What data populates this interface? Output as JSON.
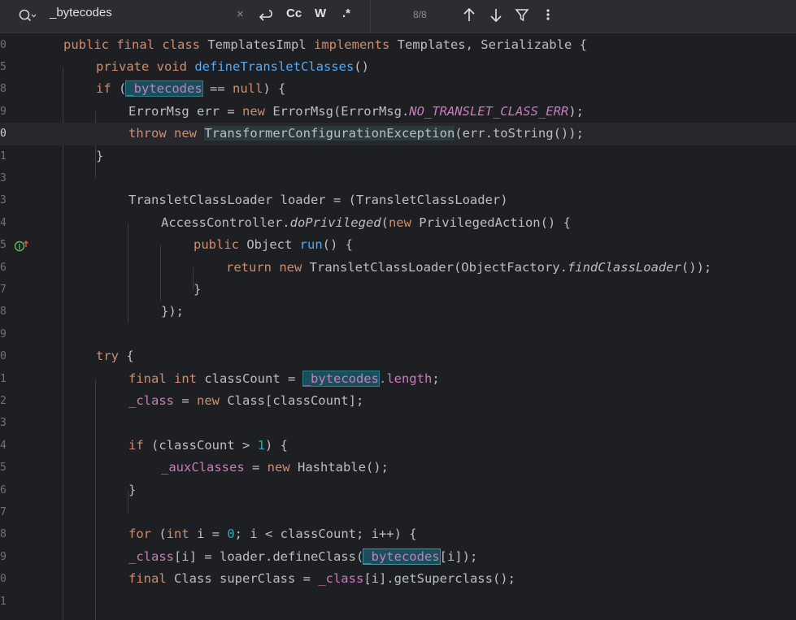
{
  "search": {
    "query": "_bytecodes",
    "clear_glyph": "×",
    "wrap_icon": "wrap-icon",
    "match_case": "Cc",
    "whole_word": "W",
    "regex": ".*",
    "match_count": "8/8",
    "prev_icon": "arrow-up-icon",
    "next_icon": "arrow-down-icon",
    "filter_icon": "filter-icon",
    "more_icon": "more-icon"
  },
  "lines": [
    {
      "num": "0",
      "indent": 0,
      "tokens": [
        [
          "kw",
          "public "
        ],
        [
          "kw",
          "final "
        ],
        [
          "kw",
          "class "
        ],
        [
          "",
          "TemplatesImpl "
        ],
        [
          "kw",
          "implements "
        ],
        [
          "",
          "Templates, Serializable {"
        ]
      ]
    },
    {
      "num": "5",
      "indent": 1,
      "tokens": [
        [
          "kw",
          "private "
        ],
        [
          "kw",
          "void "
        ],
        [
          "fn",
          "defineTransletClasses"
        ],
        [
          "",
          "()"
        ]
      ]
    },
    {
      "num": "8",
      "indent": 1,
      "tokens": [
        [
          "kw",
          "if "
        ],
        [
          "",
          "("
        ],
        [
          "fld hl",
          "_bytecodes"
        ],
        [
          "",
          " == "
        ],
        [
          "kw",
          "null"
        ],
        [
          "",
          ") {"
        ]
      ]
    },
    {
      "num": "9",
      "indent": 2,
      "tokens": [
        [
          "",
          "ErrorMsg err = "
        ],
        [
          "kw",
          "new "
        ],
        [
          "",
          "ErrorMsg(ErrorMsg."
        ],
        [
          "fld ital",
          "NO_TRANSLET_CLASS_ERR"
        ],
        [
          "",
          ");"
        ]
      ]
    },
    {
      "num": "0",
      "indent": 2,
      "tokens": [
        [
          "kw",
          "throw "
        ],
        [
          "kw",
          "new "
        ],
        [
          "refbox",
          "TransformerConfigurationException"
        ],
        [
          "",
          "(err.toString());"
        ]
      ]
    },
    {
      "num": "1",
      "indent": 1,
      "tokens": [
        [
          "",
          "}"
        ]
      ]
    },
    {
      "num": "3",
      "indent": 0,
      "tokens": []
    },
    {
      "num": "3",
      "indent": 2,
      "tokens": [
        [
          "",
          "TransletClassLoader loader = (TransletClassLoader)"
        ]
      ]
    },
    {
      "num": "4",
      "indent": 3,
      "tokens": [
        [
          "",
          "AccessController."
        ],
        [
          "ital",
          "doPrivileged"
        ],
        [
          "",
          "("
        ],
        [
          "kw",
          "new "
        ],
        [
          "",
          "PrivilegedAction() {"
        ]
      ]
    },
    {
      "num": "5",
      "indent": 4,
      "tokens": [
        [
          "kw",
          "public "
        ],
        [
          "",
          "Object "
        ],
        [
          "fn",
          "run"
        ],
        [
          "",
          "() {"
        ]
      ]
    },
    {
      "num": "6",
      "indent": 5,
      "tokens": [
        [
          "kw",
          "return "
        ],
        [
          "kw",
          "new "
        ],
        [
          "",
          "TransletClassLoader(ObjectFactory."
        ],
        [
          "ital",
          "findClassLoader"
        ],
        [
          "",
          "());"
        ]
      ]
    },
    {
      "num": "7",
      "indent": 4,
      "tokens": [
        [
          "",
          "}"
        ]
      ]
    },
    {
      "num": "8",
      "indent": 3,
      "tokens": [
        [
          "",
          "});"
        ]
      ]
    },
    {
      "num": "9",
      "indent": 0,
      "tokens": []
    },
    {
      "num": "0",
      "indent": 1,
      "tokens": [
        [
          "kw",
          "try "
        ],
        [
          "",
          "{"
        ]
      ]
    },
    {
      "num": "1",
      "indent": 2,
      "tokens": [
        [
          "kw",
          "final "
        ],
        [
          "kw",
          "int "
        ],
        [
          "",
          "classCount = "
        ],
        [
          "fld hl",
          "_bytecodes"
        ],
        [
          "fld",
          ".length"
        ],
        [
          "",
          ";"
        ]
      ]
    },
    {
      "num": "2",
      "indent": 2,
      "tokens": [
        [
          "fld",
          "_class"
        ],
        [
          "",
          " = "
        ],
        [
          "kw",
          "new "
        ],
        [
          "",
          "Class[classCount];"
        ]
      ]
    },
    {
      "num": "3",
      "indent": 0,
      "tokens": []
    },
    {
      "num": "4",
      "indent": 2,
      "tokens": [
        [
          "kw",
          "if "
        ],
        [
          "",
          "(classCount > "
        ],
        [
          "num",
          "1"
        ],
        [
          "",
          ") {"
        ]
      ]
    },
    {
      "num": "5",
      "indent": 3,
      "tokens": [
        [
          "fld",
          "_auxClasses"
        ],
        [
          "",
          " = "
        ],
        [
          "kw",
          "new "
        ],
        [
          "",
          "Hashtable();"
        ]
      ]
    },
    {
      "num": "6",
      "indent": 2,
      "tokens": [
        [
          "",
          "}"
        ]
      ]
    },
    {
      "num": "7",
      "indent": 0,
      "tokens": []
    },
    {
      "num": "8",
      "indent": 2,
      "tokens": [
        [
          "kw",
          "for "
        ],
        [
          "",
          "("
        ],
        [
          "kw",
          "int "
        ],
        [
          "",
          "i = "
        ],
        [
          "num",
          "0"
        ],
        [
          "",
          "; i < classCount; i++) {"
        ]
      ]
    },
    {
      "num": "9",
      "indent": 2,
      "tokens": [
        [
          "fld",
          "_class"
        ],
        [
          "",
          "[i] = loader.defineClass("
        ],
        [
          "fld hl2",
          "_bytecodes"
        ],
        [
          "",
          "[i]);"
        ]
      ]
    },
    {
      "num": "0",
      "indent": 2,
      "tokens": [
        [
          "kw",
          "final "
        ],
        [
          "",
          "Class superClass = "
        ],
        [
          "fld",
          "_class"
        ],
        [
          "",
          "[i].getSuperclass();"
        ]
      ]
    },
    {
      "num": "1",
      "indent": 0,
      "tokens": []
    }
  ]
}
